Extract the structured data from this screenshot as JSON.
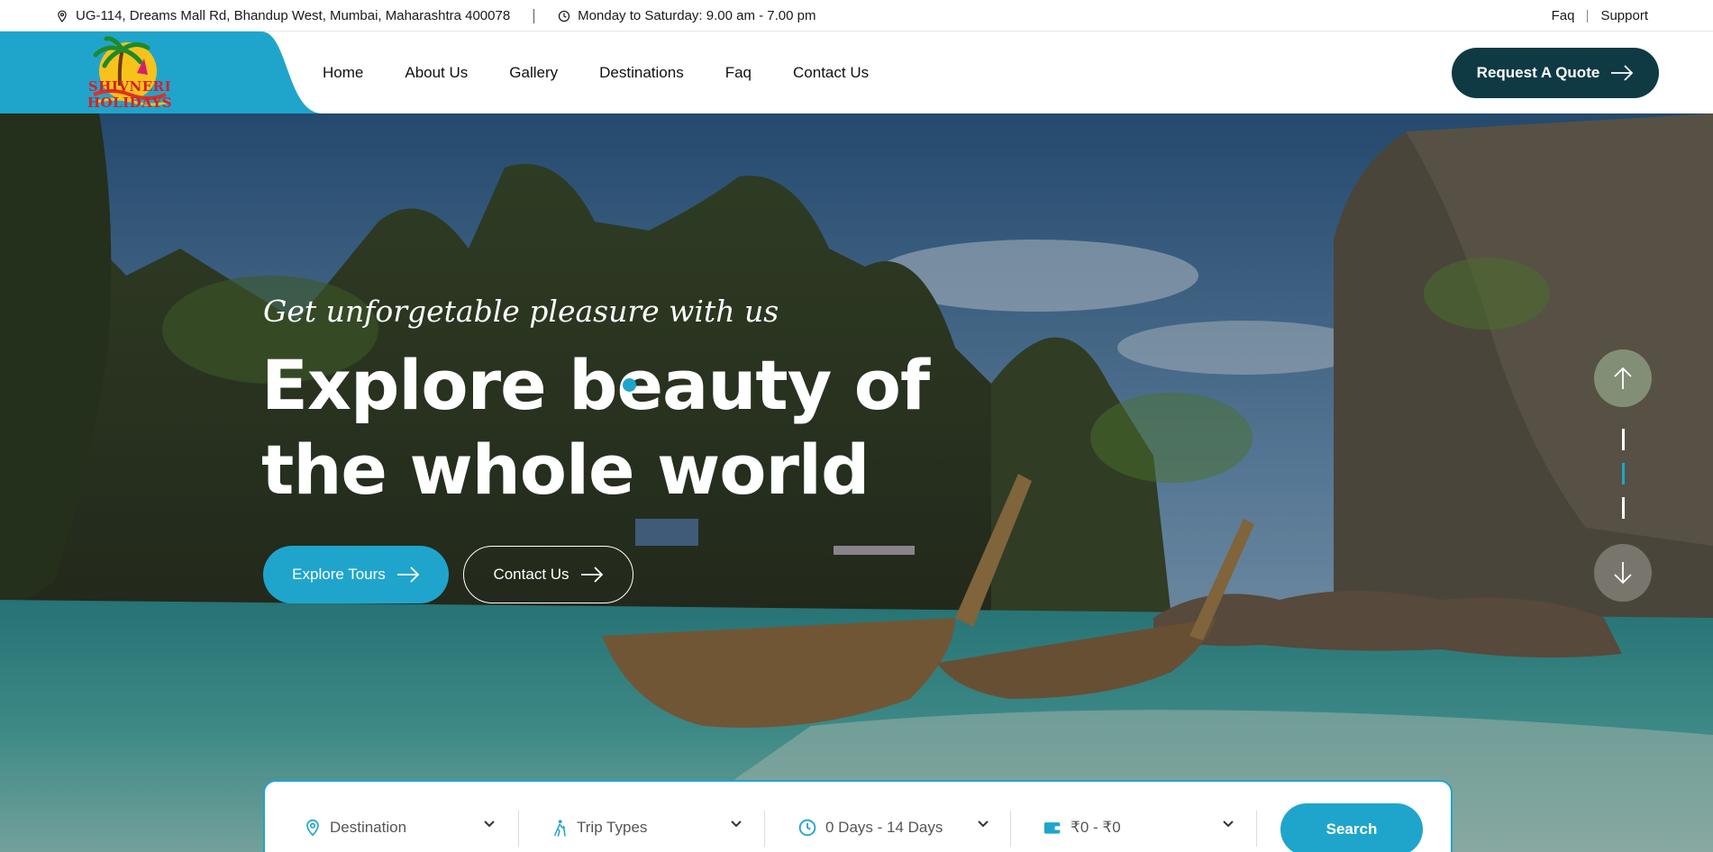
{
  "topbar": {
    "address": "UG-114, Dreams Mall Rd, Bhandup West, Mumbai, Maharashtra 400078",
    "hours": "Monday to Saturday: 9.00 am - 7.00 pm",
    "links": [
      "Faq",
      "Support"
    ]
  },
  "header": {
    "logo_text": "SHIVNERI HOLIDAYS",
    "nav": [
      "Home",
      "About Us",
      "Gallery",
      "Destinations",
      "Faq",
      "Contact Us"
    ],
    "quote_button": "Request A Quote"
  },
  "hero": {
    "tagline": "Get unforgetable pleasure with us",
    "headline_line1": "Explore beauty of",
    "headline_line2": "the whole world",
    "btn_tours": "Explore Tours",
    "btn_contact": "Contact Us",
    "pager_active": 2
  },
  "search": {
    "destination": "Destination",
    "trip_types": "Trip Types",
    "days": "0 Days - 14 Days",
    "price": "₹0 - ₹0",
    "button": "Search"
  },
  "colors": {
    "accent": "#1fa5cc",
    "dark": "#0f3a44"
  }
}
